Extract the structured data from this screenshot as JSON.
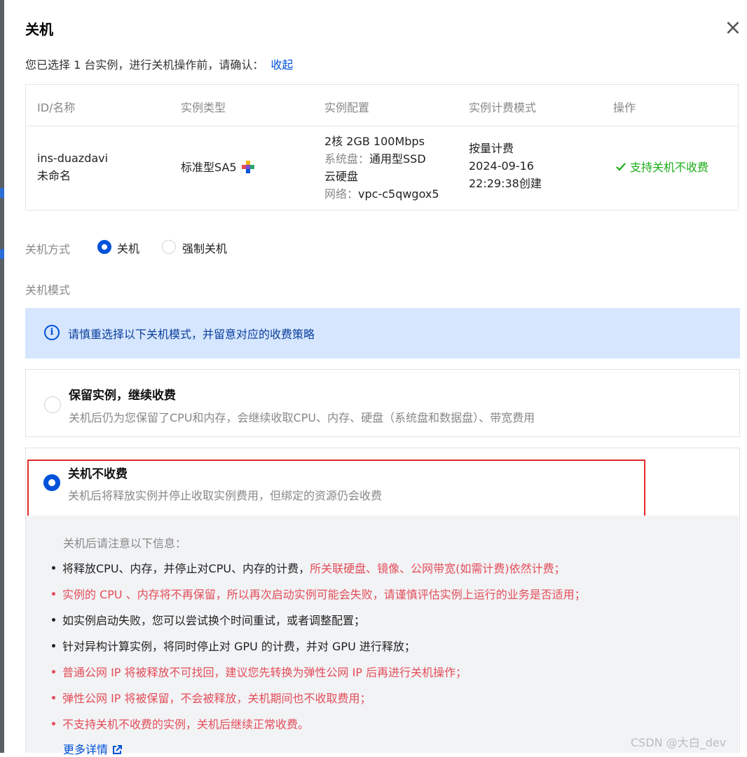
{
  "dialog": {
    "title": "关机",
    "close_glyph": "×",
    "confirm_text": "您已选择 1 台实例，进行关机操作前，请确认：",
    "collapse_link": "收起"
  },
  "table": {
    "headers": [
      "ID/名称",
      "实例类型",
      "实例配置",
      "实例计费模式",
      "操作"
    ],
    "row": {
      "id": "ins-duazdavi",
      "name": "未命名",
      "type": "标准型SA5",
      "config_line1": "2核 2GB 100Mbps",
      "config_disk_label": "系统盘：",
      "config_disk_value": "通用型SSD",
      "config_disk_value2": "云硬盘",
      "config_net_label": "网络：",
      "config_net_value": "vpc-c5qwgox5",
      "billing_mode": "按量计费",
      "billing_date": "2024-09-16",
      "billing_time": "22:29:38创建",
      "operation": "支持关机不收费"
    }
  },
  "shutdown_method": {
    "label": "关机方式",
    "options": [
      "关机",
      "强制关机"
    ],
    "selected": "关机"
  },
  "shutdown_mode": {
    "label": "关机模式",
    "info": "请慎重选择以下关机模式，并留意对应的收费策略",
    "options": [
      {
        "title": "保留实例，继续收费",
        "desc": "关机后仍为您保留了CPU和内存，会继续收取CPU、内存、硬盘（系统盘和数据盘）、带宽费用",
        "selected": false
      },
      {
        "title": "关机不收费",
        "desc": "关机后将释放实例并停止收取实例费用，但绑定的资源仍会收费",
        "selected": true
      }
    ]
  },
  "notes": {
    "heading": "关机后请注意以下信息：",
    "item1_black": "将释放CPU、内存，并停止对CPU、内存的计费，",
    "item1_red": "所关联硬盘、镜像、公网带宽(如需计费)依然计费；",
    "item2": "实例的 CPU 、内存将不再保留，所以再次启动实例可能会失败，请谨慎评估实例上运行的业务是否适用；",
    "item3": "如实例启动失败，您可以尝试换个时间重试，或者调整配置；",
    "item4": "针对异构计算实例，将同时停止对 GPU 的计费，并对 GPU 进行释放；",
    "item5": "普通公网 IP 将被释放不可找回，建议您先转换为弹性公网 IP 后再进行关机操作；",
    "item6": "弹性公网 IP 将被保留，不会被释放，关机期间也不收取费用；",
    "item7": "不支持关机不收费的实例，关机后继续正常收费。",
    "more_link": "更多详情"
  },
  "watermark": "CSDN @大白_dev",
  "colors": {
    "primary": "#0052d9",
    "success": "#1aad19",
    "danger": "#e34d59",
    "info_bg": "#d6e6ff"
  }
}
